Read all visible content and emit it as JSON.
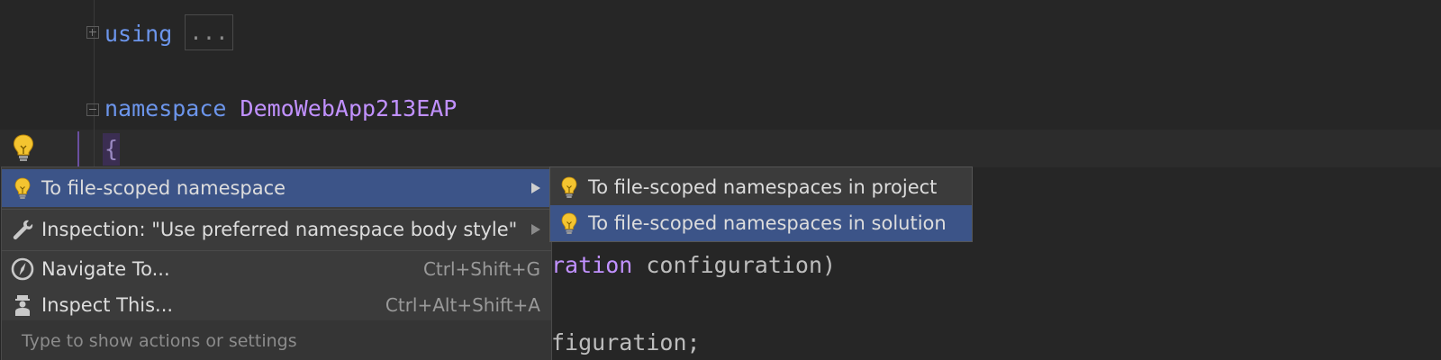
{
  "editor": {
    "lines": [
      {
        "keyword": "using",
        "collapsed": "..."
      },
      {
        "keyword": "namespace",
        "name": "DemoWebApp213EAP"
      },
      {
        "brace": "{"
      },
      {
        "fragment_a": "ration",
        "fragment_b": " configuration)"
      },
      {
        "fragment": "figuration;"
      }
    ],
    "colors": {
      "keyword": "#6c95eb",
      "namespace": "#c191ff",
      "background": "#262626"
    }
  },
  "context_menu": {
    "items": [
      {
        "label": "To file-scoped namespace",
        "icon": "lightbulb-icon",
        "has_submenu": true,
        "selected": true
      },
      {
        "label": "Inspection: \"Use preferred namespace body style\"",
        "icon": "wrench-icon",
        "has_submenu": true
      },
      {
        "label": "Navigate To...",
        "icon": "compass-icon",
        "shortcut": "Ctrl+Shift+G"
      },
      {
        "label": "Inspect This...",
        "icon": "inspector-icon",
        "shortcut": "Ctrl+Alt+Shift+A"
      }
    ],
    "footer": "Type to show actions or settings",
    "selection_color": "#3c5488"
  },
  "submenu": {
    "items": [
      {
        "label": "To file-scoped namespaces in project",
        "icon": "lightbulb-icon"
      },
      {
        "label": "To file-scoped namespaces in solution",
        "icon": "lightbulb-icon",
        "selected": true
      }
    ]
  }
}
